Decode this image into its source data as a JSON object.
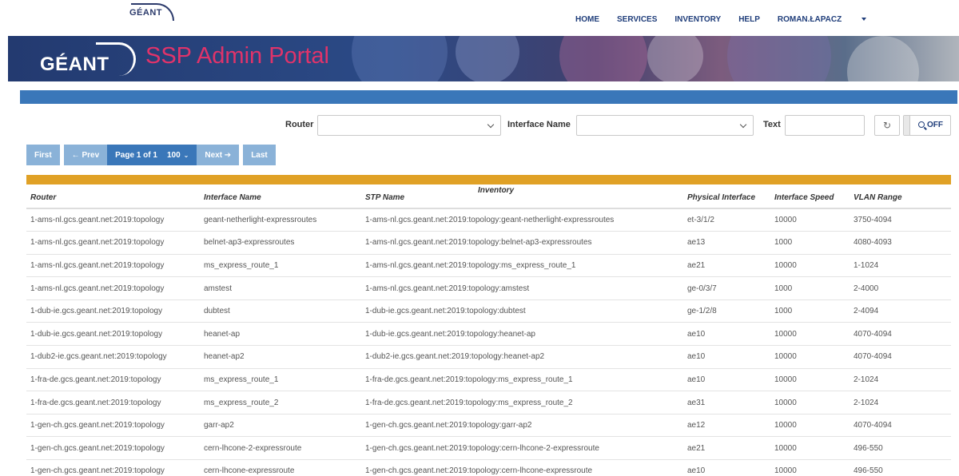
{
  "brand": {
    "logo_text": "GÉANT",
    "portal_title": "SSP Admin Portal"
  },
  "nav": {
    "items": [
      "HOME",
      "SERVICES",
      "INVENTORY",
      "HELP"
    ],
    "user": "ROMAN.ŁAPACZ"
  },
  "filters": {
    "router_label": "Router",
    "router_value": "",
    "interface_label": "Interface Name",
    "interface_value": "",
    "text_label": "Text",
    "text_value": "",
    "toggle_label": "OFF"
  },
  "pager": {
    "first": "First",
    "prev": "← Prev",
    "page_info": "Page 1 of 1",
    "page_size": "100",
    "next": "Next ➔",
    "last": "Last"
  },
  "table": {
    "title": "Inventory",
    "headers": [
      "Router",
      "Interface Name",
      "STP Name",
      "Physical Interface",
      "Interface Speed",
      "VLAN Range"
    ],
    "rows": [
      [
        "1-ams-nl.gcs.geant.net:2019:topology",
        "geant-netherlight-expressroutes",
        "1-ams-nl.gcs.geant.net:2019:topology:geant-netherlight-expressroutes",
        "et-3/1/2",
        "10000",
        "3750-4094"
      ],
      [
        "1-ams-nl.gcs.geant.net:2019:topology",
        "belnet-ap3-expressroutes",
        "1-ams-nl.gcs.geant.net:2019:topology:belnet-ap3-expressroutes",
        "ae13",
        "1000",
        "4080-4093"
      ],
      [
        "1-ams-nl.gcs.geant.net:2019:topology",
        "ms_express_route_1",
        "1-ams-nl.gcs.geant.net:2019:topology:ms_express_route_1",
        "ae21",
        "10000",
        "1-1024"
      ],
      [
        "1-ams-nl.gcs.geant.net:2019:topology",
        "amstest",
        "1-ams-nl.gcs.geant.net:2019:topology:amstest",
        "ge-0/3/7",
        "1000",
        "2-4000"
      ],
      [
        "1-dub-ie.gcs.geant.net:2019:topology",
        "dubtest",
        "1-dub-ie.gcs.geant.net:2019:topology:dubtest",
        "ge-1/2/8",
        "1000",
        "2-4094"
      ],
      [
        "1-dub-ie.gcs.geant.net:2019:topology",
        "heanet-ap",
        "1-dub-ie.gcs.geant.net:2019:topology:heanet-ap",
        "ae10",
        "10000",
        "4070-4094"
      ],
      [
        "1-dub2-ie.gcs.geant.net:2019:topology",
        "heanet-ap2",
        "1-dub2-ie.gcs.geant.net:2019:topology:heanet-ap2",
        "ae10",
        "10000",
        "4070-4094"
      ],
      [
        "1-fra-de.gcs.geant.net:2019:topology",
        "ms_express_route_1",
        "1-fra-de.gcs.geant.net:2019:topology:ms_express_route_1",
        "ae10",
        "10000",
        "2-1024"
      ],
      [
        "1-fra-de.gcs.geant.net:2019:topology",
        "ms_express_route_2",
        "1-fra-de.gcs.geant.net:2019:topology:ms_express_route_2",
        "ae31",
        "10000",
        "2-1024"
      ],
      [
        "1-gen-ch.gcs.geant.net:2019:topology",
        "garr-ap2",
        "1-gen-ch.gcs.geant.net:2019:topology:garr-ap2",
        "ae12",
        "10000",
        "4070-4094"
      ],
      [
        "1-gen-ch.gcs.geant.net:2019:topology",
        "cern-lhcone-2-expressroute",
        "1-gen-ch.gcs.geant.net:2019:topology:cern-lhcone-2-expressroute",
        "ae21",
        "10000",
        "496-550"
      ],
      [
        "1-gen-ch.gcs.geant.net:2019:topology",
        "cern-lhcone-expressroute",
        "1-gen-ch.gcs.geant.net:2019:topology:cern-lhcone-expressroute",
        "ae10",
        "10000",
        "496-550"
      ]
    ]
  },
  "colors": {
    "primary": "#3a77b9",
    "pager_light": "#8ab2d8",
    "accent": "#e0a126",
    "portal_title": "#e0336a",
    "nav_text": "#1f3d7a"
  }
}
